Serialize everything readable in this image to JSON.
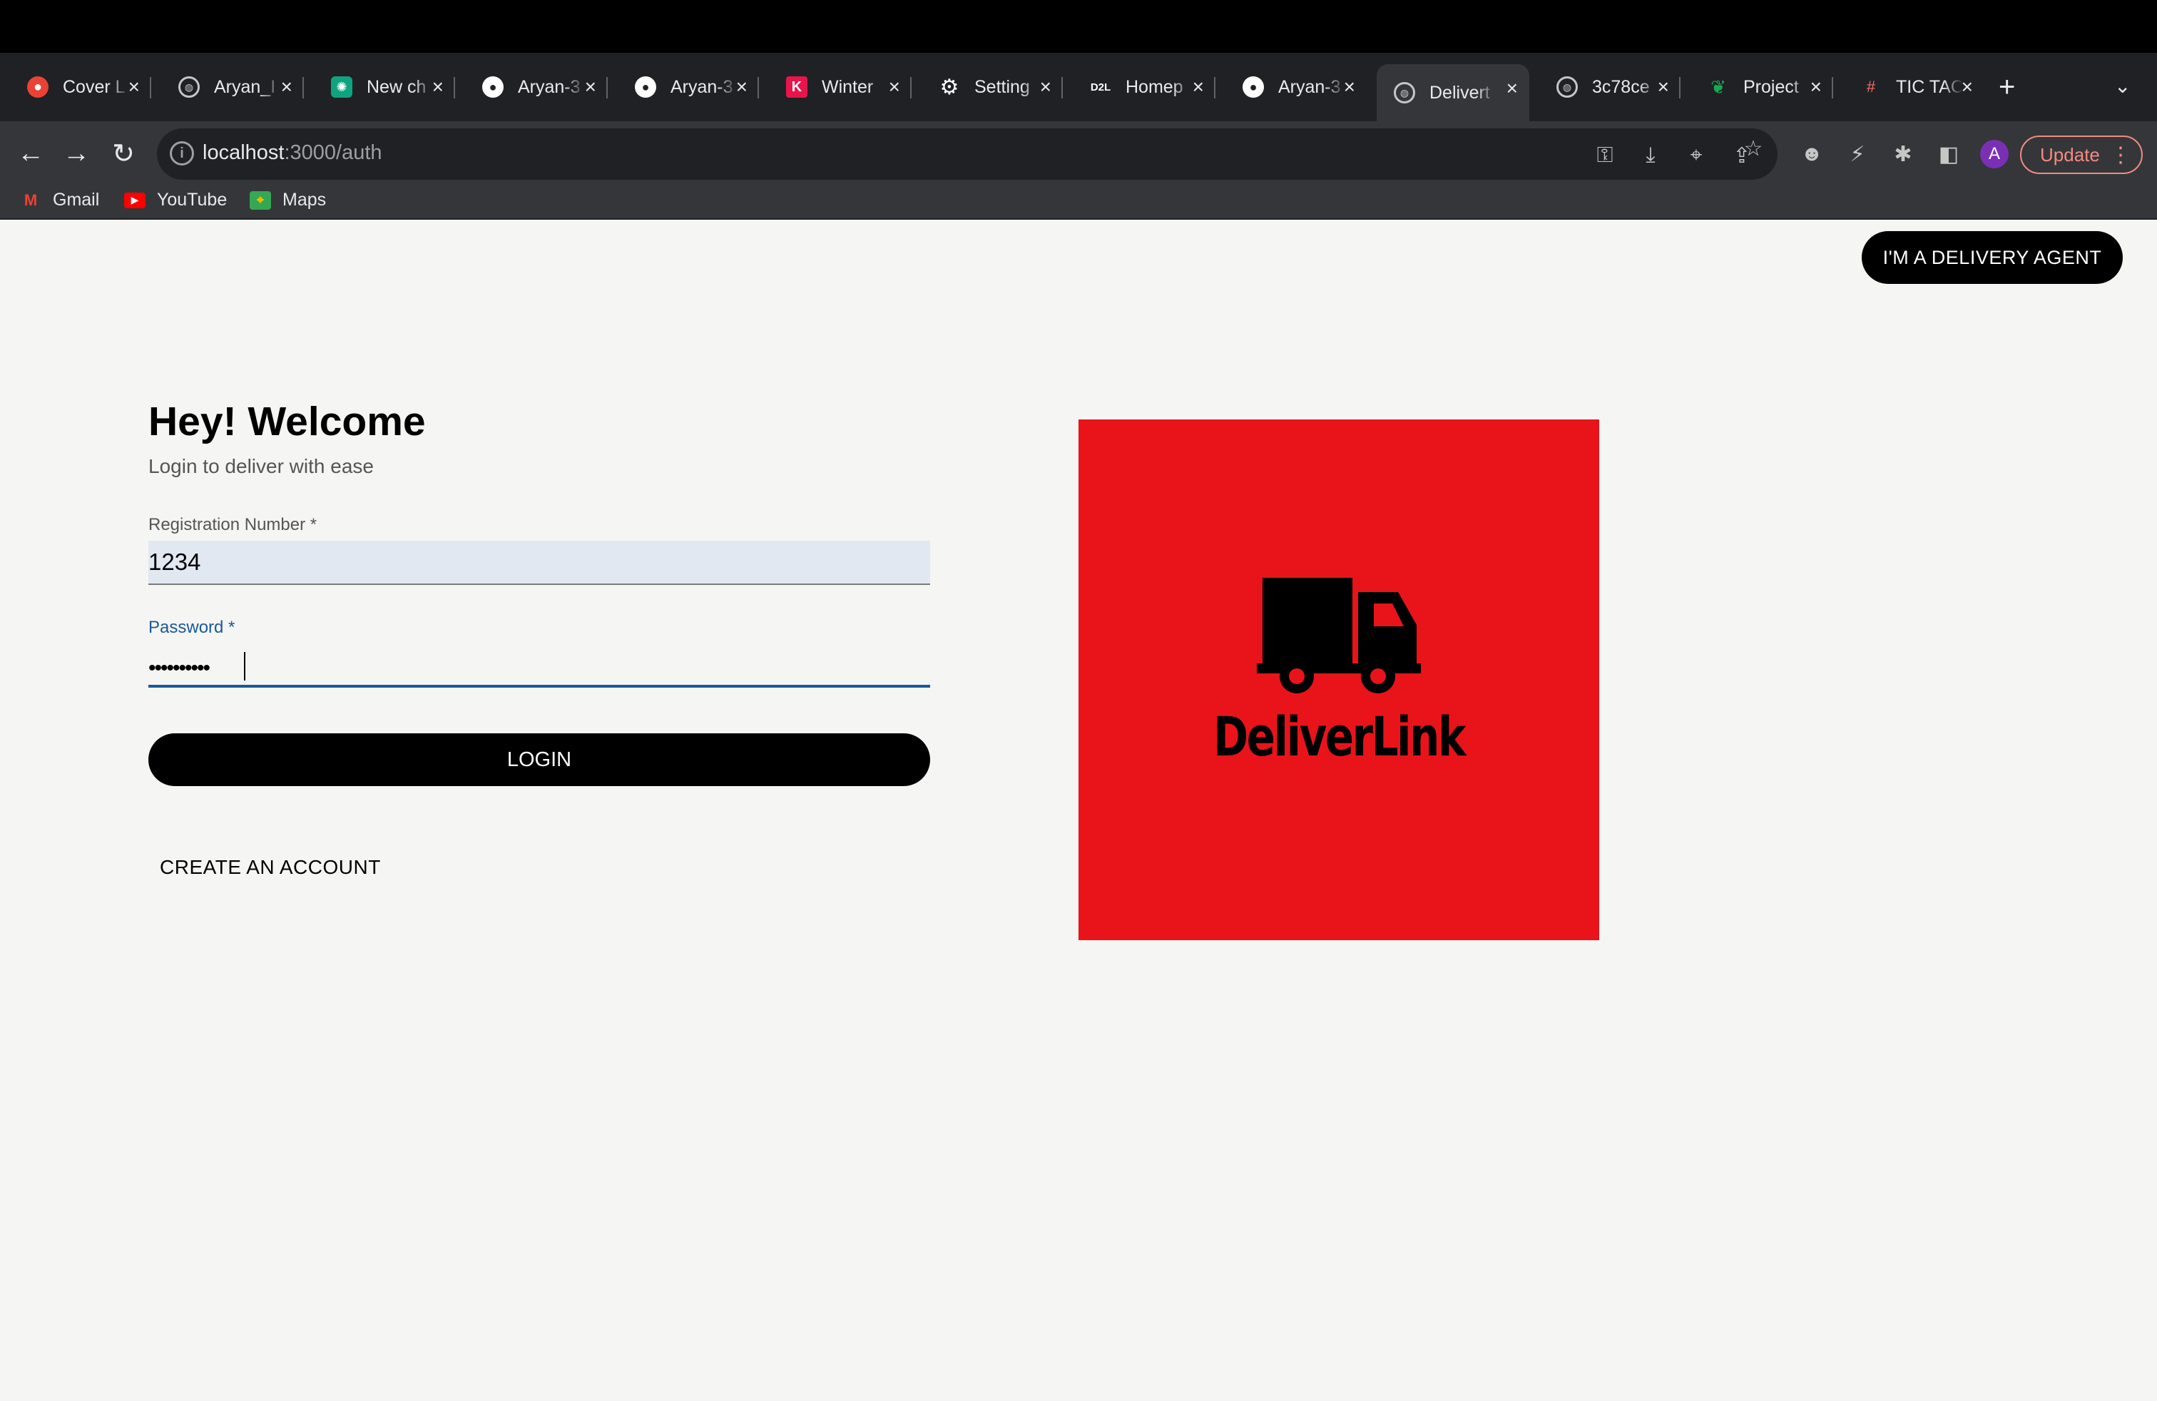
{
  "browser": {
    "tabs": [
      {
        "title": "Cover L",
        "favicon": "red-circle-icon",
        "color": "#ea4335"
      },
      {
        "title": "Aryan_I",
        "favicon": "globe-icon",
        "color": "#9aa0a6"
      },
      {
        "title": "New ch",
        "favicon": "openai-icon",
        "color": "#10a37f"
      },
      {
        "title": "Aryan-3",
        "favicon": "github-icon",
        "color": "#ffffff"
      },
      {
        "title": "Aryan-3",
        "favicon": "github-icon",
        "color": "#ffffff"
      },
      {
        "title": "Winter",
        "favicon": "k-logo-icon",
        "color": "#e8144a"
      },
      {
        "title": "Setting",
        "favicon": "gear-icon",
        "color": "#ffffff"
      },
      {
        "title": "Homep",
        "favicon": "d2l-logo-icon",
        "color": "#ffffff"
      },
      {
        "title": "Aryan-3",
        "favicon": "github-icon",
        "color": "#ffffff"
      },
      {
        "title": "Delivert",
        "favicon": "globe-icon",
        "color": "#9aa0a6"
      },
      {
        "title": "3c78ce",
        "favicon": "globe-icon",
        "color": "#9aa0a6"
      },
      {
        "title": "Project",
        "favicon": "mongodb-leaf-icon",
        "color": "#13aa52"
      },
      {
        "title": "TIC TAC",
        "favicon": "tictactoe-icon",
        "color": "#ff6b6b"
      }
    ],
    "active_tab_index": 9,
    "url_host": "localhost",
    "url_path": ":3000/auth",
    "update_label": "Update",
    "profile_initial": "A",
    "bookmarks": [
      {
        "label": "Gmail",
        "icon": "gmail-icon"
      },
      {
        "label": "YouTube",
        "icon": "youtube-icon"
      },
      {
        "label": "Maps",
        "icon": "maps-icon"
      }
    ]
  },
  "page": {
    "agent_button": "I'M A DELIVERY AGENT",
    "heading": "Hey! Welcome",
    "subheading": "Login to deliver with ease",
    "registration_label": "Registration Number *",
    "registration_value": "1234",
    "password_label": "Password *",
    "password_masked": "••••••••••",
    "login_button": "LOGIN",
    "create_account": "CREATE AN ACCOUNT",
    "logo_text": "DeliverLink",
    "logo_background": "#e8141a"
  }
}
